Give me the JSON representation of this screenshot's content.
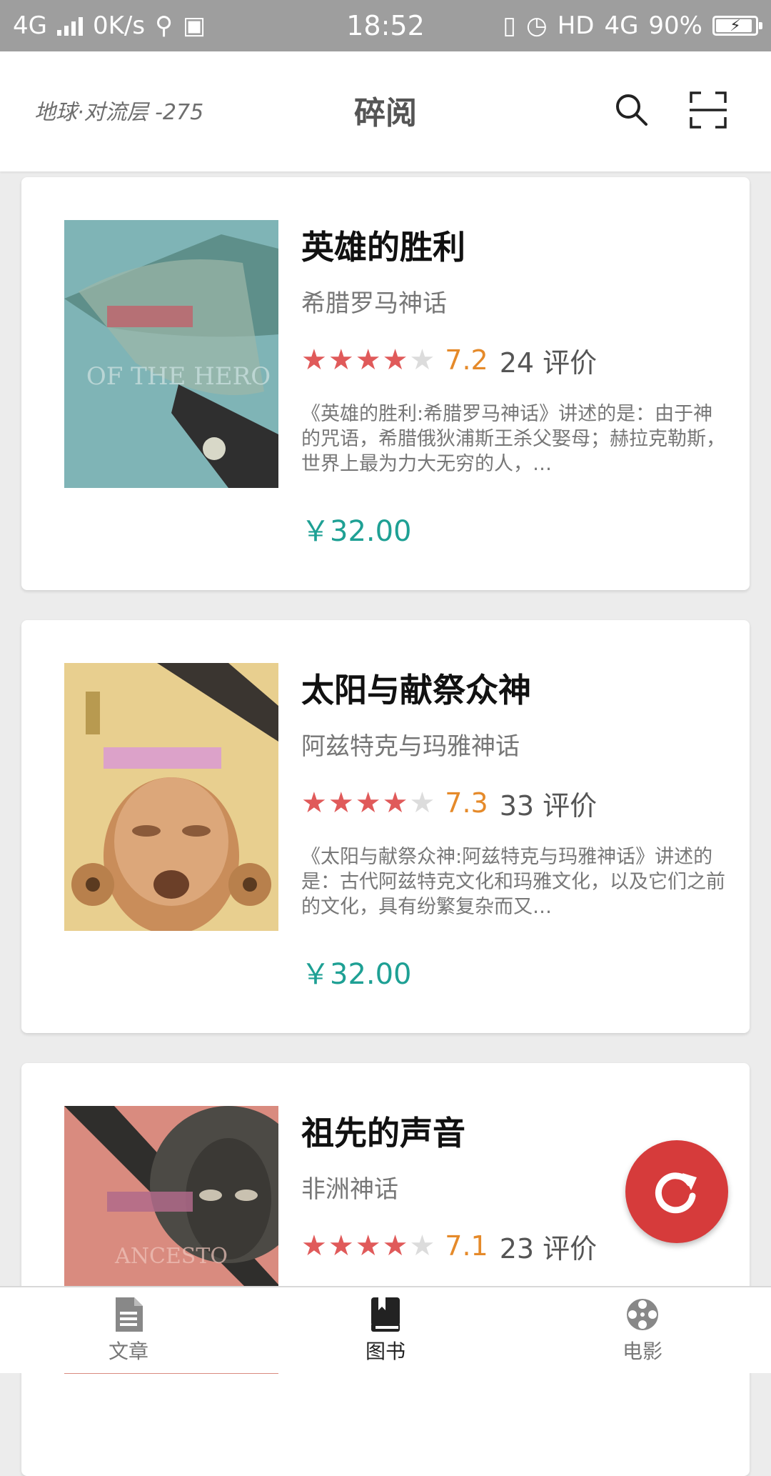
{
  "status_bar": {
    "network": "4G",
    "speed": "0K/s",
    "time": "18:52",
    "hd": "HD",
    "network_right": "4G",
    "battery": "90%"
  },
  "header": {
    "location": "地球·对流层  -275",
    "title": "碎阅",
    "search_icon": "search-icon",
    "scan_icon": "scan-icon"
  },
  "books": [
    {
      "title": "英雄的胜利",
      "subtitle": "希腊罗马神话",
      "rating_stars": 4,
      "score": "7.2",
      "count": "24 评价",
      "description": "《英雄的胜利:希腊罗马神话》讲述的是：由于神的咒语，希腊俄狄浦斯王杀父娶母；赫拉克勒斯，世界上最为力大无穷的人，…",
      "price": "￥32.00",
      "cover_colors": [
        "#7fb4b6",
        "#5e8f8a"
      ]
    },
    {
      "title": "太阳与献祭众神",
      "subtitle": "阿兹特克与玛雅神话",
      "rating_stars": 4,
      "score": "7.3",
      "count": "33 评价",
      "description": "《太阳与献祭众神:阿兹特克与玛雅神话》讲述的是：古代阿兹特克文化和玛雅文化，以及它们之前的文化，具有纷繁复杂而又…",
      "price": "￥32.00",
      "cover_colors": [
        "#e8cf8f",
        "#c98d5a"
      ]
    },
    {
      "title": "祖先的声音",
      "subtitle": "非洲神话",
      "rating_stars": 4,
      "score": "7.1",
      "count": "23 评价",
      "description": "",
      "price": "",
      "cover_colors": [
        "#d98b7f",
        "#4c4a45"
      ]
    }
  ],
  "fab": {
    "icon": "refresh-icon",
    "color": "#d63b3b"
  },
  "bottom_nav": [
    {
      "label": "文章",
      "icon": "document-icon",
      "active": false
    },
    {
      "label": "图书",
      "icon": "book-icon",
      "active": true
    },
    {
      "label": "电影",
      "icon": "film-reel-icon",
      "active": false
    }
  ],
  "colors": {
    "star_on": "#e05a5a",
    "score": "#e58a2a",
    "price": "#1ea094"
  }
}
